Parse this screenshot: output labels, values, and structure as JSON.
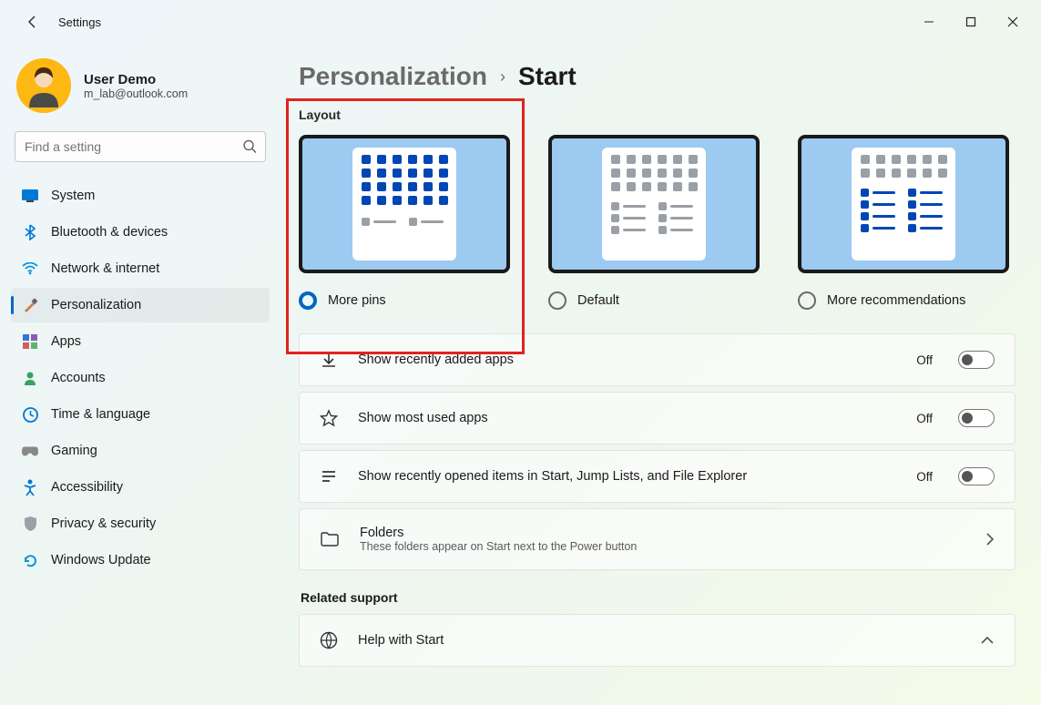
{
  "window": {
    "title": "Settings"
  },
  "user": {
    "name": "User Demo",
    "email": "m_lab@outlook.com"
  },
  "search": {
    "placeholder": "Find a setting"
  },
  "nav": {
    "items": [
      {
        "label": "System"
      },
      {
        "label": "Bluetooth & devices"
      },
      {
        "label": "Network & internet"
      },
      {
        "label": "Personalization"
      },
      {
        "label": "Apps"
      },
      {
        "label": "Accounts"
      },
      {
        "label": "Time & language"
      },
      {
        "label": "Gaming"
      },
      {
        "label": "Accessibility"
      },
      {
        "label": "Privacy & security"
      },
      {
        "label": "Windows Update"
      }
    ],
    "selected_index": 3
  },
  "breadcrumb": {
    "parent": "Personalization",
    "current": "Start"
  },
  "layout": {
    "label": "Layout",
    "options": [
      {
        "label": "More pins",
        "selected": true
      },
      {
        "label": "Default",
        "selected": false
      },
      {
        "label": "More recommendations",
        "selected": false
      }
    ]
  },
  "settings": [
    {
      "title": "Show recently added apps",
      "state": "Off"
    },
    {
      "title": "Show most used apps",
      "state": "Off"
    },
    {
      "title": "Show recently opened items in Start, Jump Lists, and File Explorer",
      "state": "Off"
    }
  ],
  "folders": {
    "title": "Folders",
    "subtitle": "These folders appear on Start next to the Power button"
  },
  "related_support": {
    "label": "Related support",
    "help_title": "Help with Start"
  },
  "colors": {
    "accent": "#0067c0",
    "highlight": "#e2231a"
  }
}
